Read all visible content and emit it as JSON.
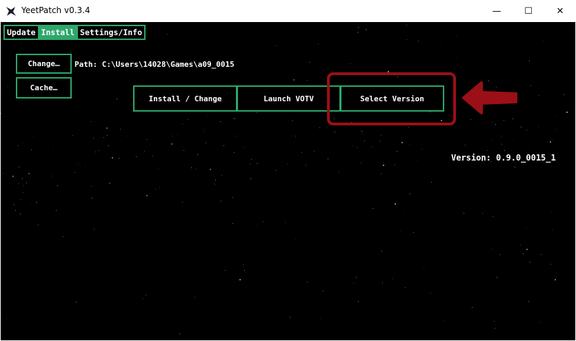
{
  "window": {
    "title": "YeetPatch v0.3.4",
    "controls": {
      "minimize": "—",
      "maximize": "☐",
      "close": "✕"
    }
  },
  "tabs": [
    {
      "label": "Update",
      "active": false
    },
    {
      "label": "Install",
      "active": true
    },
    {
      "label": "Settings/Info",
      "active": false
    }
  ],
  "install": {
    "change_label": "Change…",
    "cache_label": "Cache…",
    "path_text": "Path: C:\\Users\\14028\\Games\\a09_0015",
    "install_label": "Install / Change",
    "launch_label": "Launch VOTV",
    "select_version_label": "Select Version",
    "version_text": "Version: 0.9.0_0015_1"
  },
  "colors": {
    "accent": "#2ea86a",
    "annotation": "#9b1016",
    "background": "#000000"
  },
  "icons": {
    "app": "app-logo-icon",
    "annotation_arrow": "arrow-left-icon"
  }
}
